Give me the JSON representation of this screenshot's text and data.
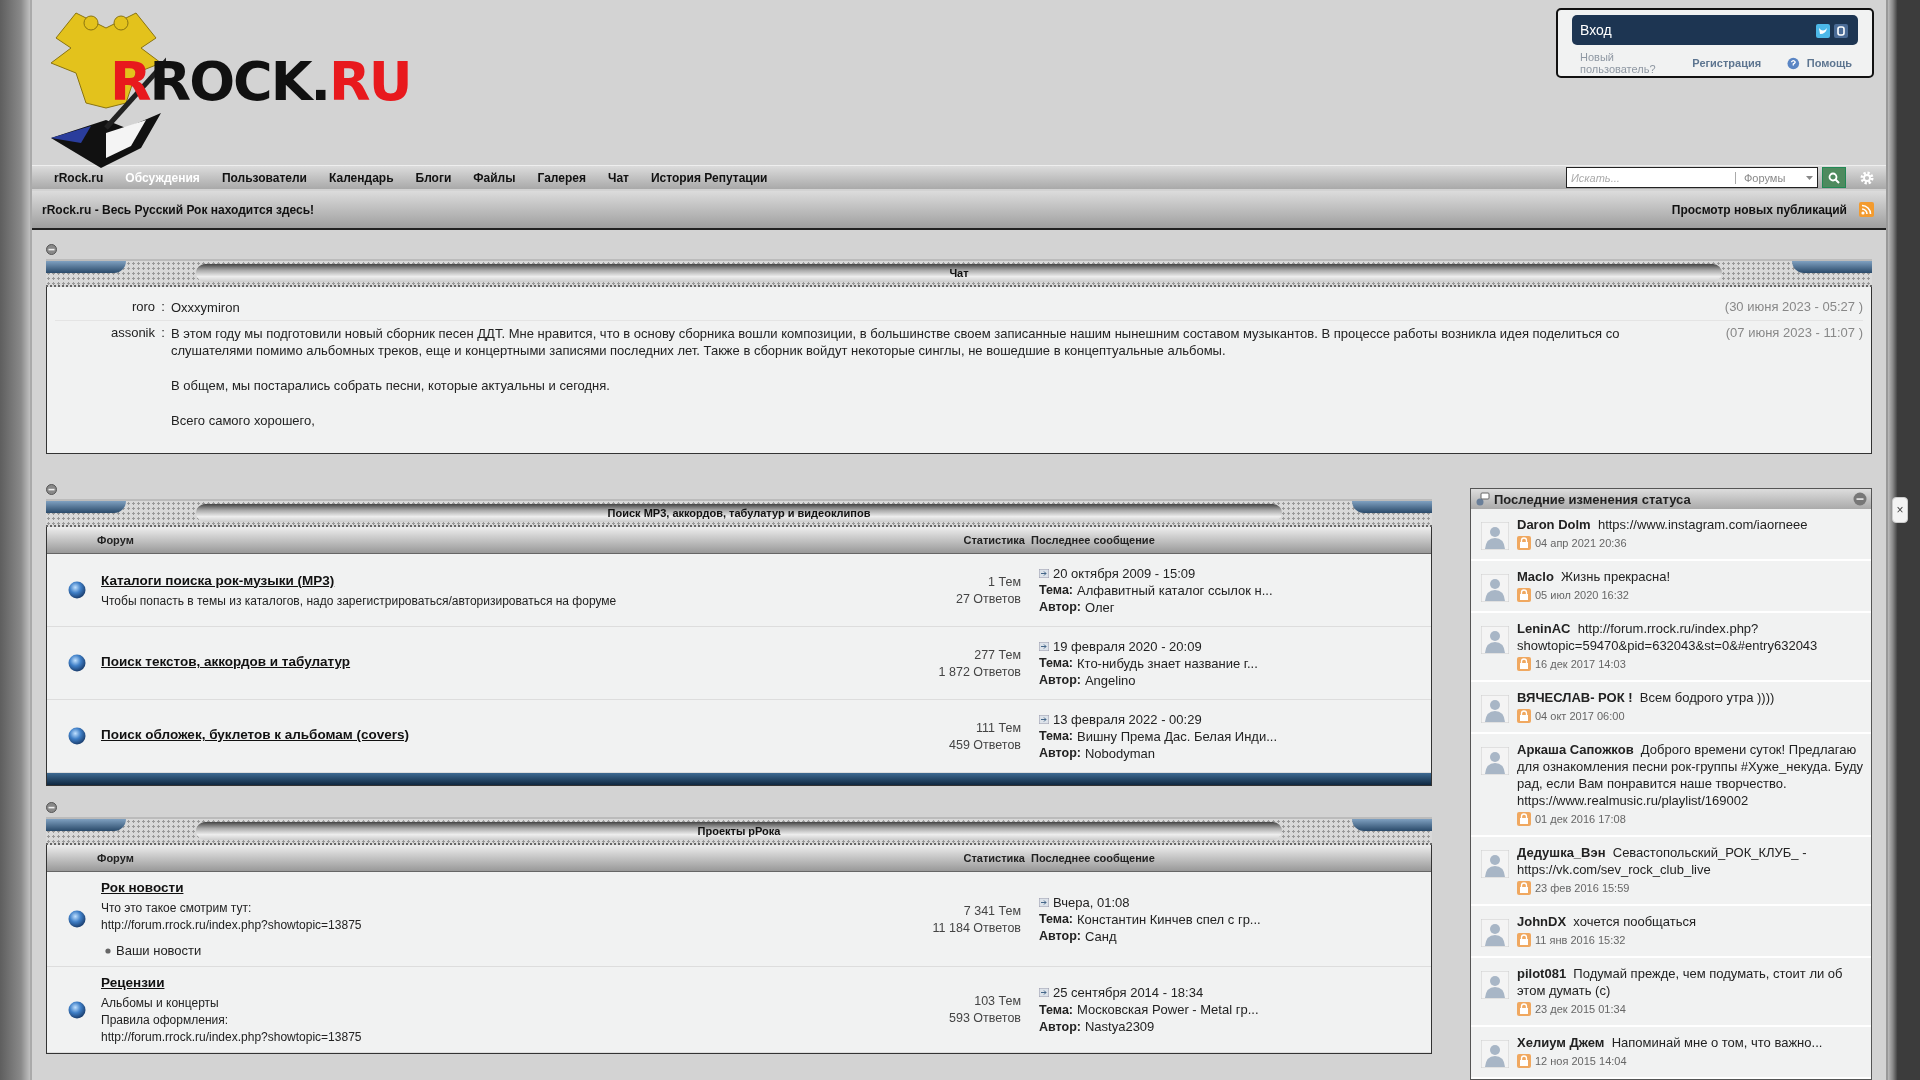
{
  "logo": {
    "parts": [
      {
        "text": "R",
        "kind": "accent"
      },
      {
        "text": "ROCK.",
        "kind": "plain"
      },
      {
        "text": "RU",
        "kind": "accent"
      }
    ]
  },
  "login": {
    "title": "Вход",
    "new_user": "Новый пользователь?",
    "register": "Регистрация",
    "help": "Помощь"
  },
  "nav": [
    {
      "label": "rRock.ru",
      "selected": false
    },
    {
      "label": "Обсуждения",
      "selected": true
    },
    {
      "label": "Пользователи",
      "selected": false
    },
    {
      "label": "Календарь",
      "selected": false
    },
    {
      "label": "Блоги",
      "selected": false
    },
    {
      "label": "Файлы",
      "selected": false
    },
    {
      "label": "Галерея",
      "selected": false
    },
    {
      "label": "Чат",
      "selected": false
    },
    {
      "label": "История Репутации",
      "selected": false
    }
  ],
  "search": {
    "placeholder": "Искать...",
    "scope": "Форумы"
  },
  "tagline": "rRock.ru - Весь Русский Рок находится здесь!",
  "new_posts": "Просмотр новых публикаций",
  "chat": {
    "title": "Чат",
    "separator": ":",
    "messages": [
      {
        "author": "roro",
        "paragraphs": [
          "Oxxxymiron"
        ],
        "time": "(30 июня 2023 - 05:27 )"
      },
      {
        "author": "assonik",
        "paragraphs": [
          "В этом году мы подготовили новый сборник песен ДДТ. Мне нравится, что в основу сборника вошли композиции, в большинстве своем записанные нашим нынешним составом музыкантов. В процессе работы возникла идея поделиться со слушателями помимо альбомных треков, еще и концертными записями последних лет. Также в сборник войдут некоторые синглы, не вошедшие в концептуальные альбомы.",
          "В общем, мы постарались собрать песни, которые актуальны и сегодня.",
          "Всего самого хорошего,"
        ],
        "time": "(07 июня 2023 - 11:07 )"
      }
    ]
  },
  "categories": [
    {
      "title": "Поиск MP3, аккордов, табулатур и видеоклипов",
      "columns": [
        "Форум",
        "Статистика",
        "Последнее сообщение"
      ],
      "footer": true,
      "forums": [
        {
          "title": "Каталоги поиска рок-музыки (MP3)",
          "description": [
            "Чтобы попасть в темы из каталогов, надо зарегистрироваться/авторизироваться на форуме"
          ],
          "topics": "1 Тем",
          "replies": "27 Ответов",
          "last": {
            "date": "20 октября 2009 - 15:09",
            "topic_label": "Тема:",
            "topic": "Алфавитный каталог ссылок н...",
            "author_label": "Автор:",
            "author": "Олег"
          }
        },
        {
          "title": "Поиск текстов, аккордов и табулатур",
          "topics": "277 Тем",
          "replies": "1 872 Ответов",
          "last": {
            "date": "19 февраля 2020 - 20:09",
            "topic_label": "Тема:",
            "topic": "Кто-нибудь знает название г...",
            "author_label": "Автор:",
            "author": "Angelino"
          }
        },
        {
          "title": "Поиск обложек, буклетов к альбомам (covers)",
          "topics": "111 Тем",
          "replies": "459 Ответов",
          "last": {
            "date": "13 февраля 2022 - 00:29",
            "topic_label": "Тема:",
            "topic": "Вишну Према Дас. Белая Инди...",
            "author_label": "Автор:",
            "author": "Nobodyman"
          }
        }
      ]
    },
    {
      "title": "Проекты рРока",
      "columns": [
        "Форум",
        "Статистика",
        "Последнее сообщение"
      ],
      "footer": false,
      "forums": [
        {
          "title": "Рок новости",
          "description": [
            "Что это такое смотрим тут:",
            "http://forum.rrock.ru/index.php?showtopic=13875"
          ],
          "subforums": [
            "Ваши новости"
          ],
          "topics": "7 341 Тем",
          "replies": "11 184 Ответов",
          "last": {
            "date": "Вчера, 01:08",
            "topic_label": "Тема:",
            "topic": "Константин Кинчев спел с гр...",
            "author_label": "Автор:",
            "author": "Санд"
          }
        },
        {
          "title": "Рецензии",
          "description": [
            "Альбомы и концерты",
            "Правила оформления:",
            "http://forum.rrock.ru/index.php?showtopic=13875"
          ],
          "topics": "103 Тем",
          "replies": "593 Ответов",
          "last": {
            "date": "25 сентября 2014 - 18:34",
            "topic_label": "Тема:",
            "topic": "Московская Power - Metal гр...",
            "author_label": "Автор:",
            "author": "Nastya2309"
          }
        }
      ]
    }
  ],
  "status_panel": {
    "title": "Последние изменения статуса",
    "items": [
      {
        "name": "Daron Dolm",
        "text": "https://www.instagram.com/iaorneee",
        "time": "04 апр 2021 20:36"
      },
      {
        "name": "Maclo",
        "text": "Жизнь прекрасна!",
        "time": "05 июл 2020 16:32"
      },
      {
        "name": "LeninAC",
        "text": "http://forum.rrock.ru/index.php?showtopic=59470&pid=632043&st=0&#entry632043",
        "time": "16 дек 2017 14:03"
      },
      {
        "name": "ВЯЧЕСЛАВ- РОК !",
        "text": "Всем бодрого утра ))))",
        "time": "04 окт 2017 06:00"
      },
      {
        "name": "Аркаша Сапожков",
        "text": "Доброго времени суток! Предлагаю для ознакомления песни рок-группы #Хуже_некуда. Буду рад, если Вам понравится наше творчество. https://www.realmusic.ru/playlist/169002",
        "time": "01 дек 2016 17:08"
      },
      {
        "name": "Дедушка_Вэн",
        "text": "Севастопольский_РОК_КЛУБ_ - https://vk.com/sev_rock_club_live",
        "time": "23 фев 2016 15:59"
      },
      {
        "name": "JohnDX",
        "text": "хочется пообщаться",
        "time": "11 янв 2016 15:32"
      },
      {
        "name": "pilot081",
        "text": "Подумай прежде, чем подумать, стоит ли об этом думать (с)",
        "time": "23 дек 2015 01:34"
      },
      {
        "name": "Хелиум Джем",
        "text": "Напоминай мне о том, что важно...",
        "time": "12 ноя 2015 14:04"
      }
    ]
  },
  "close": "×"
}
